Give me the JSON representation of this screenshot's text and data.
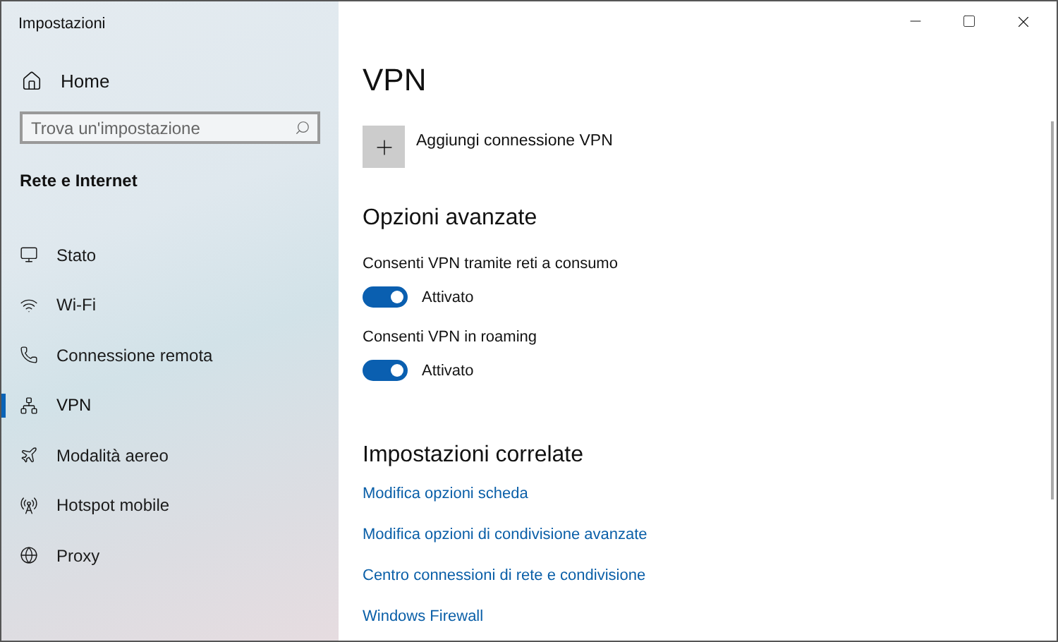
{
  "window": {
    "title": "Impostazioni"
  },
  "sidebar": {
    "home": "Home",
    "search": {
      "placeholder": "Trova un'impostazione"
    },
    "section": "Rete e Internet",
    "items": [
      {
        "kind": "status",
        "label": "Stato",
        "selected": false
      },
      {
        "kind": "wifi",
        "label": "Wi-Fi",
        "selected": false
      },
      {
        "kind": "dialup",
        "label": "Connessione remota",
        "selected": false
      },
      {
        "kind": "vpn",
        "label": "VPN",
        "selected": true
      },
      {
        "kind": "airplane",
        "label": "Modalità aereo",
        "selected": false
      },
      {
        "kind": "hotspot",
        "label": "Hotspot mobile",
        "selected": false
      },
      {
        "kind": "proxy",
        "label": "Proxy",
        "selected": false
      }
    ]
  },
  "main": {
    "title": "VPN",
    "add_button": "Aggiungi connessione VPN",
    "advanced_heading": "Opzioni avanzate",
    "toggles": [
      {
        "label": "Consenti VPN tramite reti a consumo",
        "on": true,
        "state": "Attivato"
      },
      {
        "label": "Consenti VPN in roaming",
        "on": true,
        "state": "Attivato"
      }
    ],
    "related_heading": "Impostazioni correlate",
    "links": [
      "Modifica opzioni scheda",
      "Modifica opzioni di condivisione avanzate",
      "Centro connessioni di rete e condivisione",
      "Windows Firewall"
    ]
  }
}
